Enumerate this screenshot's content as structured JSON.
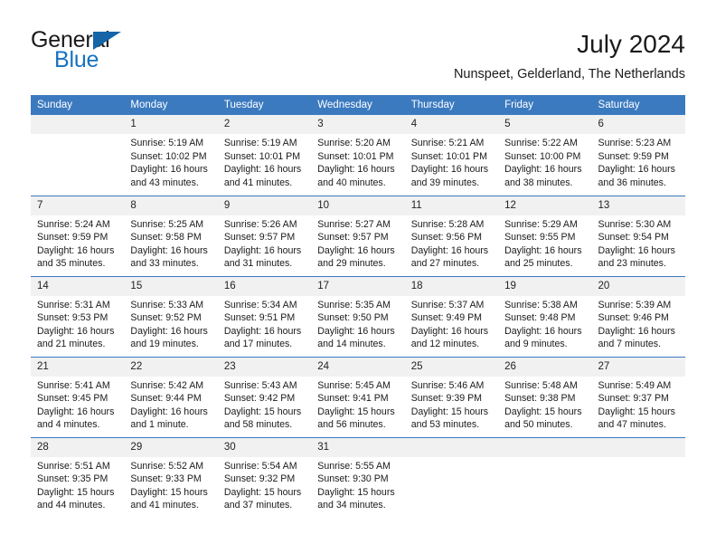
{
  "logo": {
    "word_top": "General",
    "word_bottom": "Blue",
    "triangle_color": "#1565a8",
    "blue_color": "#1672c0"
  },
  "header": {
    "title": "July 2024",
    "subtitle": "Nunspeet, Gelderland, The Netherlands"
  },
  "theme": {
    "header_blue": "#3c7ac0",
    "daynum_strip": "#f1f1f1",
    "text": "#1a1a1a"
  },
  "calendar": {
    "weekday_headers": [
      "Sunday",
      "Monday",
      "Tuesday",
      "Wednesday",
      "Thursday",
      "Friday",
      "Saturday"
    ],
    "weeks": [
      [
        {
          "day": "",
          "blank": true,
          "sunrise": "",
          "sunset": "",
          "daylight_1": "",
          "daylight_2": ""
        },
        {
          "day": "1",
          "blank": false,
          "sunrise": "Sunrise: 5:19 AM",
          "sunset": "Sunset: 10:02 PM",
          "daylight_1": "Daylight: 16 hours",
          "daylight_2": "and 43 minutes."
        },
        {
          "day": "2",
          "blank": false,
          "sunrise": "Sunrise: 5:19 AM",
          "sunset": "Sunset: 10:01 PM",
          "daylight_1": "Daylight: 16 hours",
          "daylight_2": "and 41 minutes."
        },
        {
          "day": "3",
          "blank": false,
          "sunrise": "Sunrise: 5:20 AM",
          "sunset": "Sunset: 10:01 PM",
          "daylight_1": "Daylight: 16 hours",
          "daylight_2": "and 40 minutes."
        },
        {
          "day": "4",
          "blank": false,
          "sunrise": "Sunrise: 5:21 AM",
          "sunset": "Sunset: 10:01 PM",
          "daylight_1": "Daylight: 16 hours",
          "daylight_2": "and 39 minutes."
        },
        {
          "day": "5",
          "blank": false,
          "sunrise": "Sunrise: 5:22 AM",
          "sunset": "Sunset: 10:00 PM",
          "daylight_1": "Daylight: 16 hours",
          "daylight_2": "and 38 minutes."
        },
        {
          "day": "6",
          "blank": false,
          "sunrise": "Sunrise: 5:23 AM",
          "sunset": "Sunset: 9:59 PM",
          "daylight_1": "Daylight: 16 hours",
          "daylight_2": "and 36 minutes."
        }
      ],
      [
        {
          "day": "7",
          "blank": false,
          "sunrise": "Sunrise: 5:24 AM",
          "sunset": "Sunset: 9:59 PM",
          "daylight_1": "Daylight: 16 hours",
          "daylight_2": "and 35 minutes."
        },
        {
          "day": "8",
          "blank": false,
          "sunrise": "Sunrise: 5:25 AM",
          "sunset": "Sunset: 9:58 PM",
          "daylight_1": "Daylight: 16 hours",
          "daylight_2": "and 33 minutes."
        },
        {
          "day": "9",
          "blank": false,
          "sunrise": "Sunrise: 5:26 AM",
          "sunset": "Sunset: 9:57 PM",
          "daylight_1": "Daylight: 16 hours",
          "daylight_2": "and 31 minutes."
        },
        {
          "day": "10",
          "blank": false,
          "sunrise": "Sunrise: 5:27 AM",
          "sunset": "Sunset: 9:57 PM",
          "daylight_1": "Daylight: 16 hours",
          "daylight_2": "and 29 minutes."
        },
        {
          "day": "11",
          "blank": false,
          "sunrise": "Sunrise: 5:28 AM",
          "sunset": "Sunset: 9:56 PM",
          "daylight_1": "Daylight: 16 hours",
          "daylight_2": "and 27 minutes."
        },
        {
          "day": "12",
          "blank": false,
          "sunrise": "Sunrise: 5:29 AM",
          "sunset": "Sunset: 9:55 PM",
          "daylight_1": "Daylight: 16 hours",
          "daylight_2": "and 25 minutes."
        },
        {
          "day": "13",
          "blank": false,
          "sunrise": "Sunrise: 5:30 AM",
          "sunset": "Sunset: 9:54 PM",
          "daylight_1": "Daylight: 16 hours",
          "daylight_2": "and 23 minutes."
        }
      ],
      [
        {
          "day": "14",
          "blank": false,
          "sunrise": "Sunrise: 5:31 AM",
          "sunset": "Sunset: 9:53 PM",
          "daylight_1": "Daylight: 16 hours",
          "daylight_2": "and 21 minutes."
        },
        {
          "day": "15",
          "blank": false,
          "sunrise": "Sunrise: 5:33 AM",
          "sunset": "Sunset: 9:52 PM",
          "daylight_1": "Daylight: 16 hours",
          "daylight_2": "and 19 minutes."
        },
        {
          "day": "16",
          "blank": false,
          "sunrise": "Sunrise: 5:34 AM",
          "sunset": "Sunset: 9:51 PM",
          "daylight_1": "Daylight: 16 hours",
          "daylight_2": "and 17 minutes."
        },
        {
          "day": "17",
          "blank": false,
          "sunrise": "Sunrise: 5:35 AM",
          "sunset": "Sunset: 9:50 PM",
          "daylight_1": "Daylight: 16 hours",
          "daylight_2": "and 14 minutes."
        },
        {
          "day": "18",
          "blank": false,
          "sunrise": "Sunrise: 5:37 AM",
          "sunset": "Sunset: 9:49 PM",
          "daylight_1": "Daylight: 16 hours",
          "daylight_2": "and 12 minutes."
        },
        {
          "day": "19",
          "blank": false,
          "sunrise": "Sunrise: 5:38 AM",
          "sunset": "Sunset: 9:48 PM",
          "daylight_1": "Daylight: 16 hours",
          "daylight_2": "and 9 minutes."
        },
        {
          "day": "20",
          "blank": false,
          "sunrise": "Sunrise: 5:39 AM",
          "sunset": "Sunset: 9:46 PM",
          "daylight_1": "Daylight: 16 hours",
          "daylight_2": "and 7 minutes."
        }
      ],
      [
        {
          "day": "21",
          "blank": false,
          "sunrise": "Sunrise: 5:41 AM",
          "sunset": "Sunset: 9:45 PM",
          "daylight_1": "Daylight: 16 hours",
          "daylight_2": "and 4 minutes."
        },
        {
          "day": "22",
          "blank": false,
          "sunrise": "Sunrise: 5:42 AM",
          "sunset": "Sunset: 9:44 PM",
          "daylight_1": "Daylight: 16 hours",
          "daylight_2": "and 1 minute."
        },
        {
          "day": "23",
          "blank": false,
          "sunrise": "Sunrise: 5:43 AM",
          "sunset": "Sunset: 9:42 PM",
          "daylight_1": "Daylight: 15 hours",
          "daylight_2": "and 58 minutes."
        },
        {
          "day": "24",
          "blank": false,
          "sunrise": "Sunrise: 5:45 AM",
          "sunset": "Sunset: 9:41 PM",
          "daylight_1": "Daylight: 15 hours",
          "daylight_2": "and 56 minutes."
        },
        {
          "day": "25",
          "blank": false,
          "sunrise": "Sunrise: 5:46 AM",
          "sunset": "Sunset: 9:39 PM",
          "daylight_1": "Daylight: 15 hours",
          "daylight_2": "and 53 minutes."
        },
        {
          "day": "26",
          "blank": false,
          "sunrise": "Sunrise: 5:48 AM",
          "sunset": "Sunset: 9:38 PM",
          "daylight_1": "Daylight: 15 hours",
          "daylight_2": "and 50 minutes."
        },
        {
          "day": "27",
          "blank": false,
          "sunrise": "Sunrise: 5:49 AM",
          "sunset": "Sunset: 9:37 PM",
          "daylight_1": "Daylight: 15 hours",
          "daylight_2": "and 47 minutes."
        }
      ],
      [
        {
          "day": "28",
          "blank": false,
          "sunrise": "Sunrise: 5:51 AM",
          "sunset": "Sunset: 9:35 PM",
          "daylight_1": "Daylight: 15 hours",
          "daylight_2": "and 44 minutes."
        },
        {
          "day": "29",
          "blank": false,
          "sunrise": "Sunrise: 5:52 AM",
          "sunset": "Sunset: 9:33 PM",
          "daylight_1": "Daylight: 15 hours",
          "daylight_2": "and 41 minutes."
        },
        {
          "day": "30",
          "blank": false,
          "sunrise": "Sunrise: 5:54 AM",
          "sunset": "Sunset: 9:32 PM",
          "daylight_1": "Daylight: 15 hours",
          "daylight_2": "and 37 minutes."
        },
        {
          "day": "31",
          "blank": false,
          "sunrise": "Sunrise: 5:55 AM",
          "sunset": "Sunset: 9:30 PM",
          "daylight_1": "Daylight: 15 hours",
          "daylight_2": "and 34 minutes."
        },
        {
          "day": "",
          "blank": true,
          "sunrise": "",
          "sunset": "",
          "daylight_1": "",
          "daylight_2": ""
        },
        {
          "day": "",
          "blank": true,
          "sunrise": "",
          "sunset": "",
          "daylight_1": "",
          "daylight_2": ""
        },
        {
          "day": "",
          "blank": true,
          "sunrise": "",
          "sunset": "",
          "daylight_1": "",
          "daylight_2": ""
        }
      ]
    ]
  }
}
